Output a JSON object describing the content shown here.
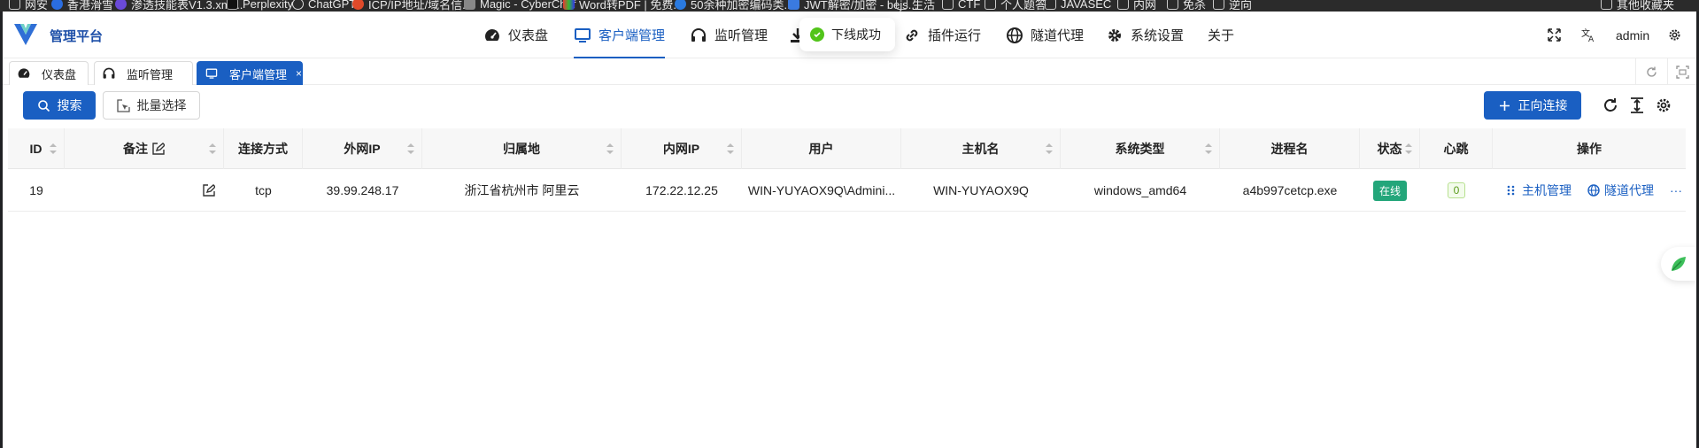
{
  "bookmarks": [
    "网安",
    "香港滑雪",
    "渗透技能表V1.3.xml...",
    "Perplexity",
    "ChatGPT",
    "ICP/IP地址/域名信...",
    "Magic - CyberChef",
    "Word转PDF | 免费...",
    "50余种加密编码类...",
    "JWT解密/加密 - bejs...",
    "生活",
    "CTF",
    "个人题答",
    "JAVASEC",
    "内网",
    "免杀",
    "逆向",
    "其他收藏夹"
  ],
  "header": {
    "brand": "管理平台",
    "nav": [
      {
        "label": "仪表盘",
        "icon": "dashboard-icon"
      },
      {
        "label": "客户端管理",
        "icon": "monitor-icon"
      },
      {
        "label": "监听管理",
        "icon": "headphones-icon"
      },
      {
        "label": "",
        "icon": "download-icon"
      },
      {
        "label": "插件运行",
        "icon": "link-icon"
      },
      {
        "label": "隧道代理",
        "icon": "globe-icon"
      },
      {
        "label": "系统设置",
        "icon": "gear-icon"
      },
      {
        "label": "关于",
        "icon": ""
      }
    ],
    "user": "admin"
  },
  "toast": {
    "message": "下线成功",
    "status": "success"
  },
  "tabs": [
    {
      "label": "仪表盘",
      "active": false
    },
    {
      "label": "监听管理",
      "active": false
    },
    {
      "label": "客户端管理",
      "active": true,
      "closable": true
    }
  ],
  "toolbar": {
    "search_label": "搜索",
    "batch_label": "批量选择",
    "forward_label": "正向连接"
  },
  "table": {
    "columns": [
      "ID",
      "备注",
      "连接方式",
      "外网IP",
      "归属地",
      "内网IP",
      "用户",
      "主机名",
      "系统类型",
      "进程名",
      "状态",
      "心跳",
      "操作"
    ],
    "rows": [
      {
        "id": "19",
        "remark": "",
        "conn": "tcp",
        "ext_ip": "39.99.248.17",
        "location": "浙江省杭州市 阿里云",
        "int_ip": "172.22.12.25",
        "user": "WIN-YUYAOX9Q\\Admini...",
        "host": "WIN-YUYAOX9Q",
        "os": "windows_amd64",
        "proc": "a4b997cetcp.exe",
        "status": "在线",
        "heartbeat": "0",
        "op_host": "主机管理",
        "op_tunnel": "隧道代理",
        "op_more": "···"
      }
    ]
  },
  "colors": {
    "primary": "#1a5fc2",
    "online": "#23a67a",
    "success": "#52c41a"
  }
}
